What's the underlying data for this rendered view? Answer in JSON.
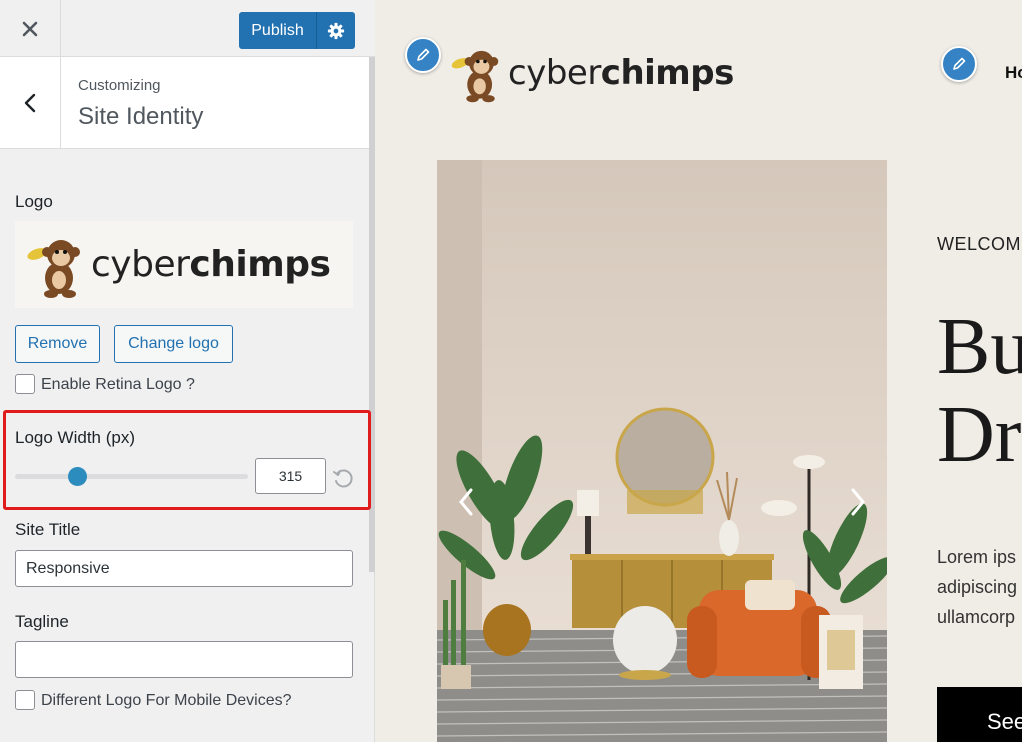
{
  "toolbar": {
    "close_icon": "close-icon",
    "publish_label": "Publish",
    "settings_icon": "gear-icon"
  },
  "section": {
    "breadcrumb": "Customizing",
    "title": "Site Identity",
    "back_icon": "chevron-left-icon"
  },
  "logo": {
    "label": "Logo",
    "wordmark_light": "cyber",
    "wordmark_bold": "chimps",
    "remove_label": "Remove",
    "change_label": "Change logo",
    "retina_label": "Enable Retina Logo ?"
  },
  "logo_width": {
    "label": "Logo Width (px)",
    "value": "315",
    "slider_fraction": 0.27,
    "reset_icon": "reset-icon"
  },
  "site_title": {
    "label": "Site Title",
    "value": "Responsive"
  },
  "tagline": {
    "label": "Tagline",
    "value": ""
  },
  "mobile_logo": {
    "label": "Different Logo For Mobile Devices?"
  },
  "preview": {
    "nav_partial": "Ho",
    "welcome": "WELCOM",
    "headline": "Bu\nDr",
    "body": "Lorem ips\nadipiscing\nullamcorp",
    "cta_label": "See",
    "logo_wordmark_light": "cyber",
    "logo_wordmark_bold": "chimps"
  },
  "colors": {
    "accent": "#2271b1",
    "highlight": "#e01b1b",
    "slider": "#2b8cbd"
  }
}
